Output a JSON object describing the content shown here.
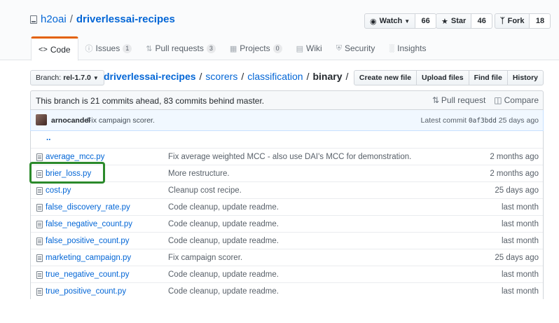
{
  "repo": {
    "owner": "h2oai",
    "name": "driverlessai-recipes"
  },
  "actions": [
    {
      "label": "Watch",
      "icon": "eye-icon",
      "count": "66"
    },
    {
      "label": "Star",
      "icon": "star-icon",
      "count": "46"
    },
    {
      "label": "Fork",
      "icon": "fork-icon",
      "count": "18"
    }
  ],
  "tabs": [
    {
      "label": "Code",
      "icon": "code-icon",
      "count": ""
    },
    {
      "label": "Issues",
      "icon": "issue-icon",
      "count": "1"
    },
    {
      "label": "Pull requests",
      "icon": "pull-request-icon",
      "count": "3"
    },
    {
      "label": "Projects",
      "icon": "project-icon",
      "count": "0"
    },
    {
      "label": "Wiki",
      "icon": "book-icon",
      "count": ""
    },
    {
      "label": "Security",
      "icon": "shield-icon",
      "count": ""
    },
    {
      "label": "Insights",
      "icon": "graph-icon",
      "count": ""
    }
  ],
  "branch": {
    "prefix": "Branch:",
    "name": "rel-1.7.0"
  },
  "breadcrumb": {
    "root": "driverlessai-recipes",
    "p1": "scorers",
    "p2": "classification",
    "current": "binary"
  },
  "file_buttons": [
    "Create new file",
    "Upload files",
    "Find file",
    "History"
  ],
  "branch_info": {
    "message": "This branch is 21 commits ahead, 83 commits behind master.",
    "pull_request": "Pull request",
    "compare": "Compare"
  },
  "commit": {
    "author": "arnocandel",
    "message": "Fix campaign scorer.",
    "latest_label": "Latest commit",
    "sha": "0af3bdd",
    "age": "25 days ago"
  },
  "parent_dir": "..",
  "files": [
    {
      "name": "average_mcc.py",
      "message": "Fix average weighted MCC - also use DAI's MCC for demonstration.",
      "age": "2 months ago"
    },
    {
      "name": "brier_loss.py",
      "message": "More restructure.",
      "age": "2 months ago"
    },
    {
      "name": "cost.py",
      "message": "Cleanup cost recipe.",
      "age": "25 days ago"
    },
    {
      "name": "false_discovery_rate.py",
      "message": "Code cleanup, update readme.",
      "age": "last month"
    },
    {
      "name": "false_negative_count.py",
      "message": "Code cleanup, update readme.",
      "age": "last month"
    },
    {
      "name": "false_positive_count.py",
      "message": "Code cleanup, update readme.",
      "age": "last month"
    },
    {
      "name": "marketing_campaign.py",
      "message": "Fix campaign scorer.",
      "age": "25 days ago"
    },
    {
      "name": "true_negative_count.py",
      "message": "Code cleanup, update readme.",
      "age": "last month"
    },
    {
      "name": "true_positive_count.py",
      "message": "Code cleanup, update readme.",
      "age": "last month"
    }
  ],
  "colors": {
    "link": "#0366d6",
    "tab_accent": "#e36209",
    "highlight": "#2b8a2b"
  }
}
